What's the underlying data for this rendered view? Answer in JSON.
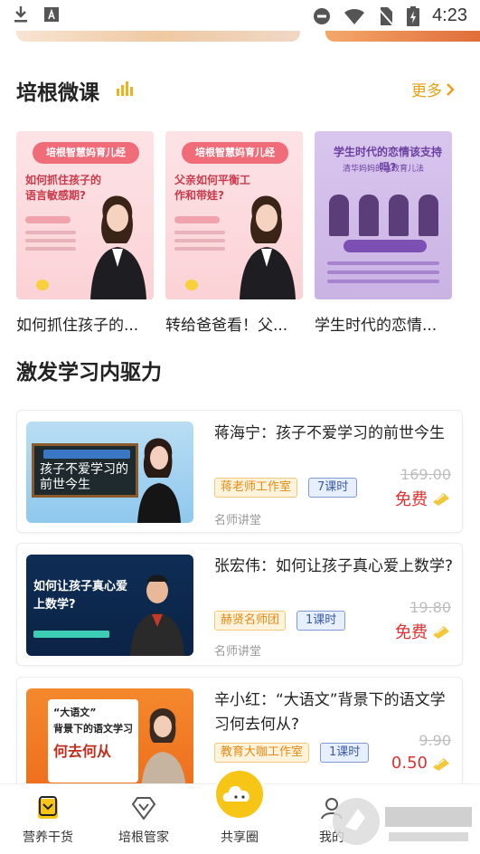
{
  "status_bar": {
    "time": "4:23"
  },
  "section_micro": {
    "title": "培根微课",
    "more": "更多",
    "cards": [
      {
        "tag": "培根智慧妈育儿经",
        "question": "如何抓住孩子的语言敏感期?",
        "title": "如何抓住孩子的..."
      },
      {
        "tag": "培根智慧妈育儿经",
        "question": "父亲如何平衡工作和带娃?",
        "title": "转给爸爸看！父..."
      },
      {
        "question": "学生时代的恋情该支持吗?",
        "sub": "清华妈妈的高效育儿法",
        "title": "学生时代的恋情..."
      }
    ]
  },
  "section_motivation": {
    "title": "激发学习内驱力",
    "courses": [
      {
        "title": "蒋海宁：孩子不爱学习的前世今生",
        "org": "蒋老师工作室",
        "lessons": "7课时",
        "original_price": "169.00",
        "price": "免费",
        "source": "名师讲堂",
        "thumb_text": "孩子不爱学习的前世今生"
      },
      {
        "title": "张宏伟：如何让孩子真心爱上数学?",
        "org": "赫贤名师团",
        "lessons": "1课时",
        "original_price": "19.80",
        "price": "免费",
        "source": "名师讲堂",
        "thumb_text": "如何让孩子真心爱上数学?"
      },
      {
        "title": "辛小红：“大语文”背景下的语文学习何去何从?",
        "org": "教育大咖工作室",
        "lessons": "1课时",
        "original_price": "9.90",
        "price": "0.50",
        "thumb_t1": "“大语文”",
        "thumb_t2": "背景下的语文学习",
        "thumb_t3": "何去何从"
      }
    ]
  },
  "bottom_nav": {
    "items": [
      {
        "label": "营养干货"
      },
      {
        "label": "培根管家"
      },
      {
        "label": "共享圈"
      },
      {
        "label": "我的"
      }
    ]
  },
  "colors": {
    "accent": "#f6c516",
    "more": "#e8a114",
    "price": "#e03030"
  }
}
